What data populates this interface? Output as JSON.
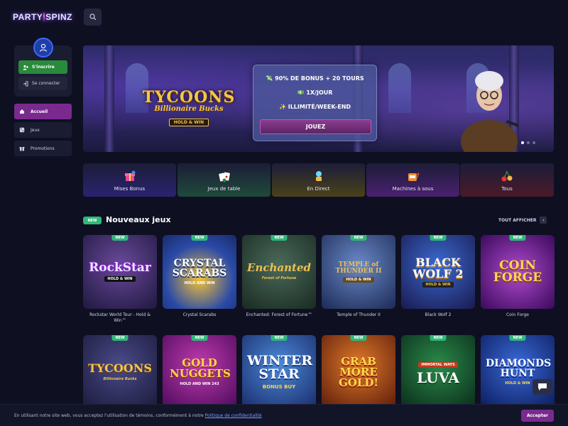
{
  "brand": {
    "logo_left": "PARTY",
    "logo_right": "SPINZ"
  },
  "sidebar": {
    "register_label": "S'inscrire",
    "login_label": "Se connecter",
    "items": [
      {
        "label": "Accueil",
        "icon": "home-icon",
        "active": true
      },
      {
        "label": "Jeux",
        "icon": "dice-icon",
        "active": false
      },
      {
        "label": "Promotions",
        "icon": "gift-icon",
        "active": false
      }
    ]
  },
  "hero": {
    "game_title": "TYCOONS",
    "game_tm": "TM",
    "game_subtitle": "Billionaire Bucks",
    "game_badge": "HOLD & WIN",
    "promo_line1": "💸 90% DE BONUS + 20 TOURS",
    "promo_line2": "💵 1X/JOUR",
    "promo_line3": "✨ ILLIMITÉ/WEEK-END",
    "cta_label": "JOUEZ",
    "slides": 3,
    "active_slide": 1
  },
  "categories": [
    {
      "label": "Mises Bonus",
      "icon": "gift-box-icon",
      "color": "#3a2a8f"
    },
    {
      "label": "Jeux de table",
      "icon": "cards-icon",
      "color": "#2a6f3f"
    },
    {
      "label": "En Direct",
      "icon": "live-dealer-icon",
      "color": "#6b5a1a"
    },
    {
      "label": "Machines à sous",
      "icon": "slot-machine-icon",
      "color": "#6a2a8a"
    },
    {
      "label": "Tous",
      "icon": "cherries-icon",
      "color": "#5a1a2a"
    }
  ],
  "section": {
    "badge": "NEW",
    "title": "Nouveaux jeux",
    "see_all": "TOUT AFFICHER"
  },
  "games_row1": [
    {
      "art": "RockStar",
      "sub": "HOLD & WIN",
      "caption": "Rockstar World Tour - Hold & Win™",
      "badge": "NEW"
    },
    {
      "art": "CRYSTAL SCARABS",
      "sub": "HOLD AND WIN",
      "caption": "Crystal Scarabs",
      "badge": "NEW"
    },
    {
      "art": "Enchanted",
      "sub": "Forest of Fortune",
      "caption": "Enchanted: Forest of Fortune™",
      "badge": "NEW"
    },
    {
      "art": "TEMPLE of THUNDER II",
      "sub": "HOLD & WIN",
      "caption": "Temple of Thunder II",
      "badge": "NEW"
    },
    {
      "art": "BLACK WOLF 2",
      "sub": "HOLD & WIN",
      "caption": "Black Wolf 2",
      "badge": "NEW"
    },
    {
      "art": "COIN FORGE",
      "sub": "",
      "caption": "Coin Forge",
      "badge": "NEW"
    }
  ],
  "games_row2": [
    {
      "art": "TYCOONS",
      "sub": "Billionaire Bucks",
      "badge": "NEW"
    },
    {
      "art": "GOLD NUGGETS",
      "sub": "HOLD AND WIN 243",
      "badge": "NEW"
    },
    {
      "art": "WINTER STAR",
      "sub": "BONUS BUY",
      "badge": "NEW"
    },
    {
      "art": "GRAB MORE GOLD!",
      "sub": "",
      "badge": "NEW"
    },
    {
      "art": "LUVA",
      "sub": "IMMORTAL WAYS",
      "badge": "NEW"
    },
    {
      "art": "DIAMONDS HUNT",
      "sub": "HOLD & WIN",
      "badge": "NEW"
    }
  ],
  "cookie": {
    "text": "En utilisant notre site web, vous acceptez l'utilisation de témoins, conformément à notre ",
    "link": "Politique de confidentialité",
    "accept_label": "Accepter"
  }
}
